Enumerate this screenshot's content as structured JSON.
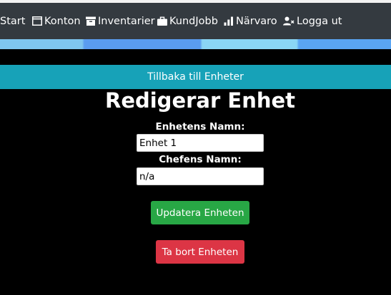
{
  "nav": {
    "items": [
      {
        "label": "Start",
        "icon": "none"
      },
      {
        "label": "Konton",
        "icon": "window-icon"
      },
      {
        "label": "Inventarier",
        "icon": "archive-icon"
      },
      {
        "label": "KundJobb",
        "icon": "briefcase-icon"
      },
      {
        "label": "Närvaro",
        "icon": "bar-chart-icon"
      },
      {
        "label": "Logga ut",
        "icon": "user-x-icon"
      }
    ]
  },
  "back_link": "Tillbaka till Enheter",
  "page_title": "Redigerar Enhet",
  "form": {
    "unit_name_label": "Enhetens Namn:",
    "unit_name_value": "Enhet 1",
    "manager_name_label": "Chefens Namn:",
    "manager_name_value": "n/a",
    "update_button": "Updatera Enheten",
    "delete_button": "Ta bort Enheten"
  },
  "colors": {
    "navbar": "#343a40",
    "back_bar": "#17a2b8",
    "update_button": "#28a745",
    "delete_button": "#dc3545"
  }
}
